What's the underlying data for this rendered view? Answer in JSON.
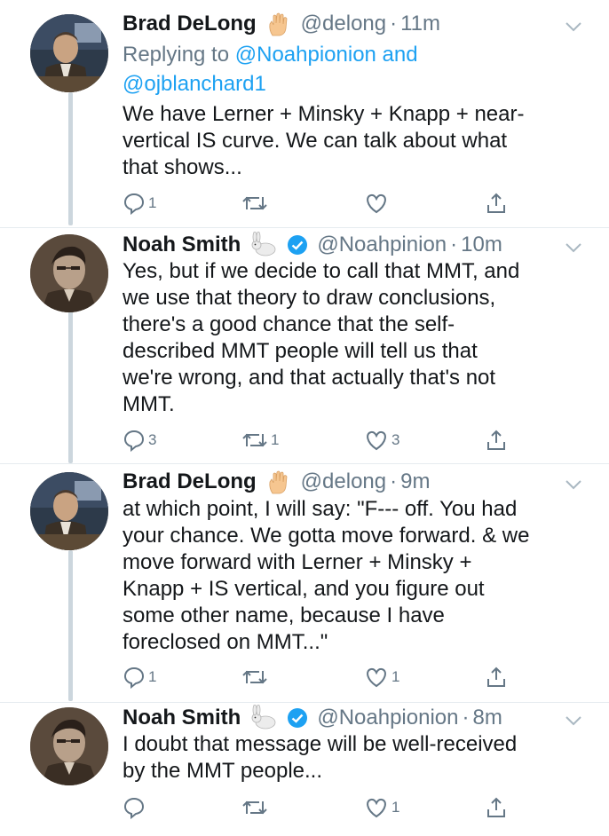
{
  "tweets": [
    {
      "name": "Brad DeLong",
      "emoji": "raised-hand-icon",
      "verified": false,
      "handle": "@delong",
      "separator": "·",
      "time": "11m",
      "replying_prefix": "Replying to",
      "replying_to": "@Noahpionion and",
      "replying_to_2": "@ojblanchard1",
      "text": "We have Lerner + Minsky + Knapp + near-\nvertical IS curve. We can talk about what\nthat shows...",
      "replies": "1",
      "retweets": "",
      "likes": ""
    },
    {
      "name": "Noah Smith",
      "emoji": "rabbit-icon",
      "verified": true,
      "handle": "@Noahpinion",
      "separator": "·",
      "time": "10m",
      "text": "Yes, but if we decide to call that MMT, and\nwe use that theory to draw conclusions,\nthere's a good chance that the self-\ndescribed MMT people will tell us that\nwe're wrong, and that actually that's not\nMMT.",
      "replies": "3",
      "retweets": "1",
      "likes": "3"
    },
    {
      "name": "Brad DeLong",
      "emoji": "raised-hand-icon",
      "verified": false,
      "handle": "@delong",
      "separator": "·",
      "time": "9m",
      "text": "at which point, I will say: \"F--- off. You had\nyour chance. We gotta move forward. & we\nmove forward with Lerner + Minsky +\nKnapp + IS vertical, and you figure out\nsome other name, because I have\nforeclosed on MMT...\"",
      "replies": "1",
      "retweets": "",
      "likes": "1"
    },
    {
      "name": "Noah Smith",
      "emoji": "rabbit-icon",
      "verified": true,
      "handle": "@Noahpionion",
      "separator": "·",
      "time": "8m",
      "text": "I doubt that message will be well-received\nby the MMT people...",
      "replies": "",
      "retweets": "",
      "likes": "1"
    }
  ],
  "colors": {
    "link": "#1da1f2",
    "muted": "#657786",
    "text": "#14171a",
    "thread_line": "#ccd6dd"
  },
  "icons": {
    "reply": "speech-bubble-icon",
    "retweet": "retweet-icon",
    "like": "heart-icon",
    "share": "share-icon",
    "more": "chevron-down-icon",
    "verified": "verified-badge-icon"
  }
}
